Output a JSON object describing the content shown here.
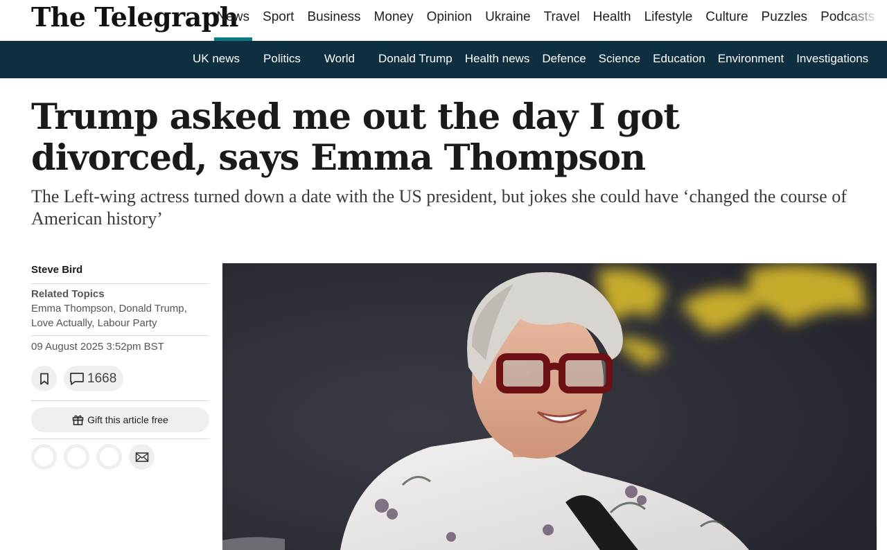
{
  "brand": {
    "logo": "The Telegraph",
    "accent": "#0a7a85",
    "subbar_color": "#0d2f3f"
  },
  "main_nav": [
    "News",
    "Sport",
    "Business",
    "Money",
    "Opinion",
    "Ukraine",
    "Travel",
    "Health",
    "Lifestyle",
    "Culture",
    "Puzzles",
    "Podcasts"
  ],
  "sub_nav": [
    "UK news",
    "Politics",
    "World",
    "Donald Trump",
    "Health news",
    "Defence",
    "Science",
    "Education",
    "Environment",
    "Investigations"
  ],
  "article": {
    "headline": "Trump asked me out the day I got divorced, says Emma Thompson",
    "standfirst": "The Left-wing actress turned down a date with the US president, but jokes she could have ‘changed the course of American history’",
    "author": "Steve Bird",
    "related_title": "Related Topics",
    "related_topics": "Emma Thompson, Donald Trump, Love Actually, Labour Party",
    "date": "09 August 2025 3:52pm BST",
    "comment_count": "1668",
    "gift_label": "Gift this article free"
  },
  "icons": {
    "bookmark": "bookmark-icon",
    "comment": "comment-icon",
    "gift": "gift-icon",
    "email": "email-icon"
  }
}
